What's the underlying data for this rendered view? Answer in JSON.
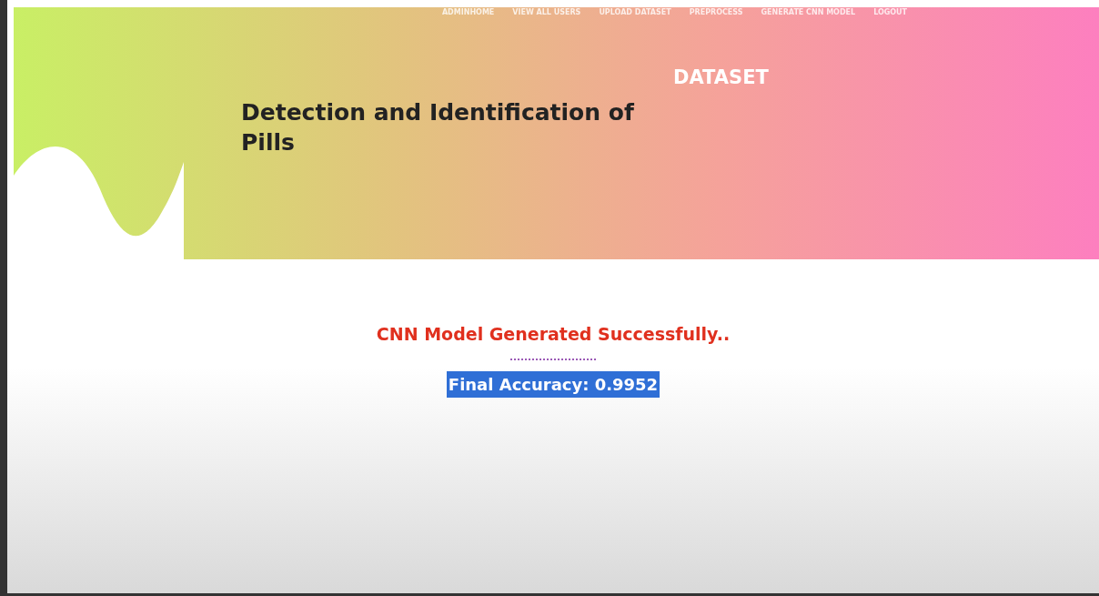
{
  "nav": {
    "items": [
      {
        "label": "ADMINHOME"
      },
      {
        "label": "VIEW ALL USERS"
      },
      {
        "label": "UPLOAD DATASET"
      },
      {
        "label": "PREPROCESS"
      },
      {
        "label": "GENERATE CNN MODEL"
      },
      {
        "label": "LOGOUT"
      }
    ]
  },
  "hero": {
    "page_title": "DATASET",
    "site_title": "Detection and Identification of Pills"
  },
  "result": {
    "message": "CNN Model Generated Successfully..",
    "accuracy": "Final Accuracy: 0.9952",
    "highlighted": true
  }
}
